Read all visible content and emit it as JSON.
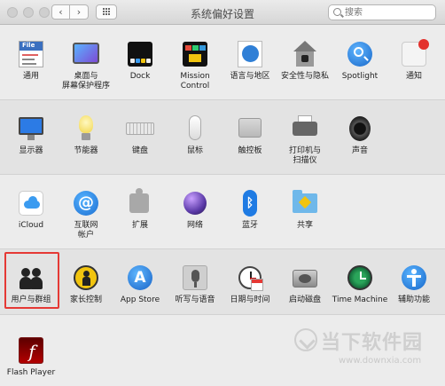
{
  "window": {
    "title": "系统偏好设置",
    "back_glyph": "‹",
    "forward_glyph": "›",
    "search_placeholder": "搜索"
  },
  "rows": [
    [
      {
        "label": "通用",
        "icon": "general-icon"
      },
      {
        "label": "桌面与\n屏幕保护程序",
        "icon": "desktop-screensaver-icon"
      },
      {
        "label": "Dock",
        "icon": "dock-icon"
      },
      {
        "label": "Mission\nControl",
        "icon": "mission-control-icon"
      },
      {
        "label": "语言与地区",
        "icon": "language-region-icon"
      },
      {
        "label": "安全性与隐私",
        "icon": "security-privacy-icon"
      },
      {
        "label": "Spotlight",
        "icon": "spotlight-icon"
      },
      {
        "label": "通知",
        "icon": "notifications-icon"
      }
    ],
    [
      {
        "label": "显示器",
        "icon": "displays-icon"
      },
      {
        "label": "节能器",
        "icon": "energy-saver-icon"
      },
      {
        "label": "键盘",
        "icon": "keyboard-icon"
      },
      {
        "label": "鼠标",
        "icon": "mouse-icon"
      },
      {
        "label": "触控板",
        "icon": "trackpad-icon"
      },
      {
        "label": "打印机与\n扫描仪",
        "icon": "printer-icon"
      },
      {
        "label": "声音",
        "icon": "sound-icon"
      }
    ],
    [
      {
        "label": "iCloud",
        "icon": "icloud-icon"
      },
      {
        "label": "互联网\n帐户",
        "icon": "internet-accounts-icon"
      },
      {
        "label": "扩展",
        "icon": "extensions-icon"
      },
      {
        "label": "网络",
        "icon": "network-icon"
      },
      {
        "label": "蓝牙",
        "icon": "bluetooth-icon"
      },
      {
        "label": "共享",
        "icon": "sharing-icon"
      }
    ],
    [
      {
        "label": "用户与群组",
        "icon": "users-groups-icon"
      },
      {
        "label": "家长控制",
        "icon": "parental-controls-icon"
      },
      {
        "label": "App Store",
        "icon": "app-store-icon"
      },
      {
        "label": "听写与语音",
        "icon": "dictation-speech-icon"
      },
      {
        "label": "日期与时间",
        "icon": "date-time-icon"
      },
      {
        "label": "启动磁盘",
        "icon": "startup-disk-icon"
      },
      {
        "label": "Time Machine",
        "icon": "time-machine-icon"
      },
      {
        "label": "辅助功能",
        "icon": "accessibility-icon"
      }
    ],
    [
      {
        "label": "Flash Player",
        "icon": "flash-player-icon"
      }
    ]
  ],
  "doc_icon_text": "File",
  "bluetooth_glyph": "ᛒ",
  "at_glyph": "@",
  "app_store_glyph": "A",
  "flash_glyph": "f",
  "watermark": {
    "text": "当下软件园",
    "url": "www.downxia.com"
  },
  "colors": {
    "highlight": "#e53935"
  }
}
